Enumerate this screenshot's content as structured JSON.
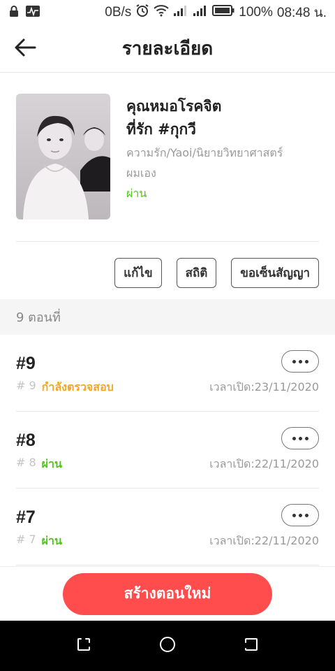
{
  "status_bar": {
    "net_speed": "0B/s",
    "battery": "100%",
    "time": "08:48 น."
  },
  "header": {
    "title": "รายละเอียด"
  },
  "book": {
    "title_line1": "คุณหมอโรคจิต",
    "title_line2": "ที่รัก #กุกวี",
    "genre": "ความรัก/Yaoi/นิยายวิทยาศาสตร์",
    "author": "ผมเอง",
    "status": "ผ่าน"
  },
  "actions": {
    "edit": "แก้ไข",
    "stats": "สถิติ",
    "contract": "ขอเซ็นสัญญา"
  },
  "episodes_header": "9 ตอนที่",
  "episodes": [
    {
      "title": "#9",
      "num": "# 9",
      "status": "กำลังตรวจสอบ",
      "status_color": "#f5a623",
      "date": "เวลาเปิด:23/11/2020"
    },
    {
      "title": "#8",
      "num": "# 8",
      "status": "ผ่าน",
      "status_color": "#52c41a",
      "date": "เวลาเปิด:22/11/2020"
    },
    {
      "title": "#7",
      "num": "# 7",
      "status": "ผ่าน",
      "status_color": "#52c41a",
      "date": "เวลาเปิด:22/11/2020"
    }
  ],
  "create_button": "สร้างตอนใหม่",
  "colors": {
    "accent": "#ff4c4c",
    "pass": "#52c41a",
    "reviewing": "#f5a623"
  }
}
